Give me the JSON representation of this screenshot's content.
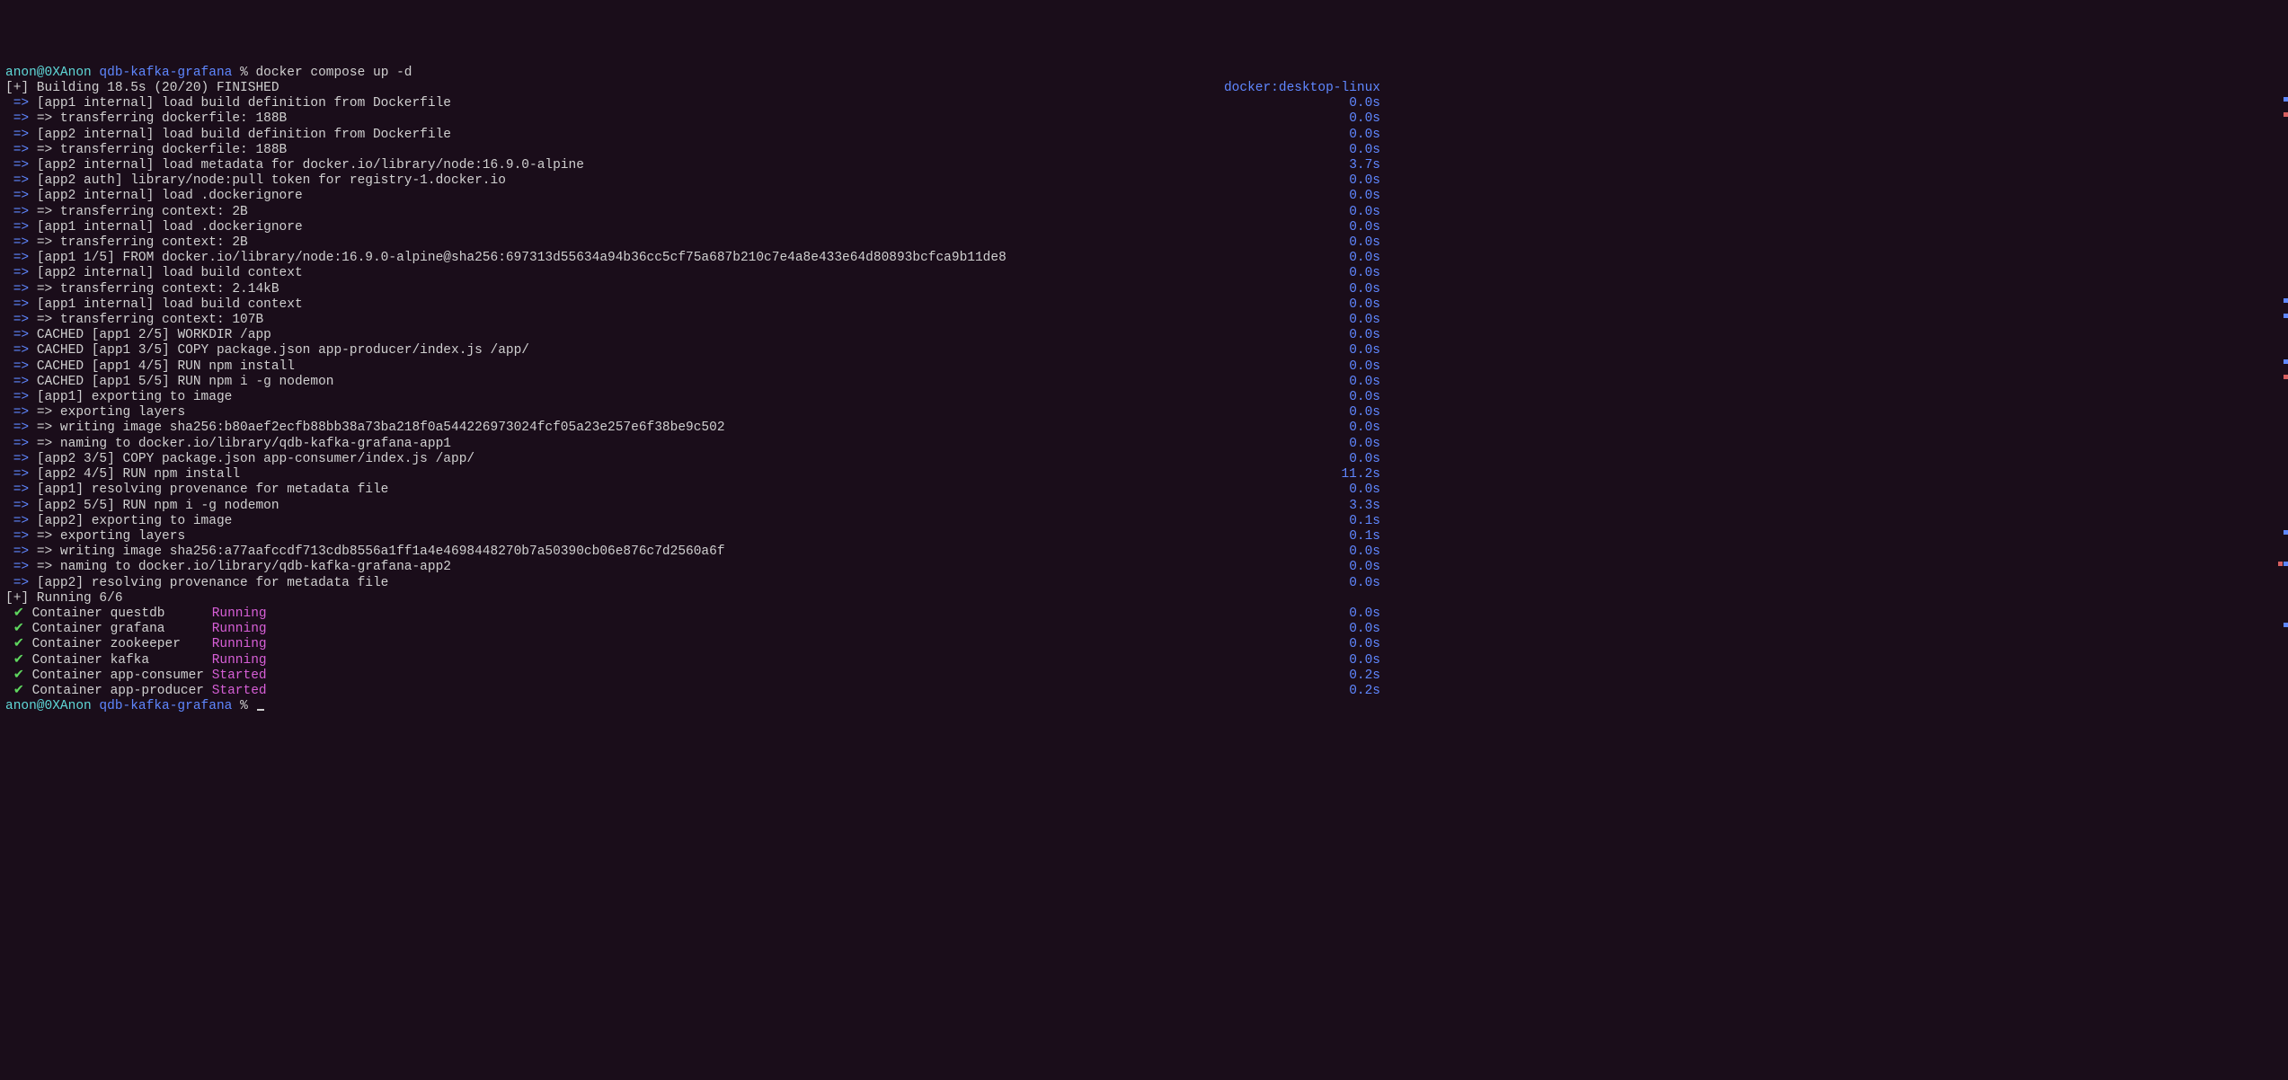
{
  "prompt1": {
    "user_host": "anon@0XAnon",
    "dir": "qdb-kafka-grafana",
    "sep": "%",
    "cmd": "docker compose up -d"
  },
  "build_header": {
    "prefix": "[+]",
    "text": "Building 18.5s (20/20) FINISHED",
    "right": "docker:desktop-linux"
  },
  "steps": [
    {
      "left": "[app1 internal] load build definition from Dockerfile",
      "right": "0.0s"
    },
    {
      "left": "=> transferring dockerfile: 188B",
      "right": "0.0s",
      "sub": true
    },
    {
      "left": "[app2 internal] load build definition from Dockerfile",
      "right": "0.0s"
    },
    {
      "left": "=> transferring dockerfile: 188B",
      "right": "0.0s",
      "sub": true
    },
    {
      "left": "[app2 internal] load metadata for docker.io/library/node:16.9.0-alpine",
      "right": "3.7s"
    },
    {
      "left": "[app2 auth] library/node:pull token for registry-1.docker.io",
      "right": "0.0s"
    },
    {
      "left": "[app2 internal] load .dockerignore",
      "right": "0.0s"
    },
    {
      "left": "=> transferring context: 2B",
      "right": "0.0s",
      "sub": true
    },
    {
      "left": "[app1 internal] load .dockerignore",
      "right": "0.0s"
    },
    {
      "left": "=> transferring context: 2B",
      "right": "0.0s",
      "sub": true
    },
    {
      "left": "[app1 1/5] FROM docker.io/library/node:16.9.0-alpine@sha256:697313d55634a94b36cc5cf75a687b210c7e4a8e433e64d80893bcfca9b11de8",
      "right": "0.0s"
    },
    {
      "left": "[app2 internal] load build context",
      "right": "0.0s"
    },
    {
      "left": "=> transferring context: 2.14kB",
      "right": "0.0s",
      "sub": true
    },
    {
      "left": "[app1 internal] load build context",
      "right": "0.0s"
    },
    {
      "left": "=> transferring context: 107B",
      "right": "0.0s",
      "sub": true
    },
    {
      "left": "CACHED [app1 2/5] WORKDIR /app",
      "right": "0.0s"
    },
    {
      "left": "CACHED [app1 3/5] COPY package.json app-producer/index.js /app/",
      "right": "0.0s"
    },
    {
      "left": "CACHED [app1 4/5] RUN npm install",
      "right": "0.0s"
    },
    {
      "left": "CACHED [app1 5/5] RUN npm i -g nodemon",
      "right": "0.0s"
    },
    {
      "left": "[app1] exporting to image",
      "right": "0.0s"
    },
    {
      "left": "=> exporting layers",
      "right": "0.0s",
      "sub": true
    },
    {
      "left": "=> writing image sha256:b80aef2ecfb88bb38a73ba218f0a544226973024fcf05a23e257e6f38be9c502",
      "right": "0.0s",
      "sub": true
    },
    {
      "left": "=> naming to docker.io/library/qdb-kafka-grafana-app1",
      "right": "0.0s",
      "sub": true
    },
    {
      "left": "[app2 3/5] COPY package.json app-consumer/index.js /app/",
      "right": "0.0s"
    },
    {
      "left": "[app2 4/5] RUN npm install",
      "right": "11.2s"
    },
    {
      "left": "[app1] resolving provenance for metadata file",
      "right": "0.0s"
    },
    {
      "left": "[app2 5/5] RUN npm i -g nodemon",
      "right": "3.3s"
    },
    {
      "left": "[app2] exporting to image",
      "right": "0.1s"
    },
    {
      "left": "=> exporting layers",
      "right": "0.1s",
      "sub": true
    },
    {
      "left": "=> writing image sha256:a77aafccdf713cdb8556a1ff1a4e4698448270b7a50390cb06e876c7d2560a6f",
      "right": "0.0s",
      "sub": true
    },
    {
      "left": "=> naming to docker.io/library/qdb-kafka-grafana-app2",
      "right": "0.0s",
      "sub": true
    },
    {
      "left": "[app2] resolving provenance for metadata file",
      "right": "0.0s"
    }
  ],
  "running_header": {
    "prefix": "[+]",
    "text": "Running 6/6"
  },
  "containers": [
    {
      "name": "Container questdb",
      "status": "Running",
      "time": "0.0s"
    },
    {
      "name": "Container grafana",
      "status": "Running",
      "time": "0.0s"
    },
    {
      "name": "Container zookeeper",
      "status": "Running",
      "time": "0.0s"
    },
    {
      "name": "Container kafka",
      "status": "Running",
      "time": "0.0s"
    },
    {
      "name": "Container app-consumer",
      "status": "Started",
      "time": "0.2s"
    },
    {
      "name": "Container app-producer",
      "status": "Started",
      "time": "0.2s"
    }
  ],
  "prompt2": {
    "user_host": "anon@0XAnon",
    "dir": "qdb-kafka-grafana",
    "sep": "%"
  },
  "arrow": "=>",
  "check": "✔"
}
